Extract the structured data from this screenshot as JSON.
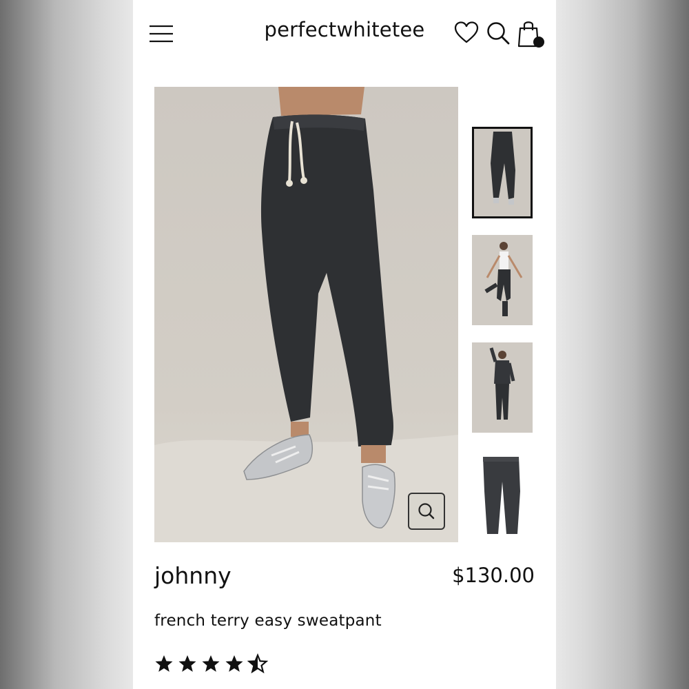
{
  "header": {
    "logo_text": "perfectwhitetee",
    "icons": [
      "menu-icon",
      "heart-icon",
      "search-icon",
      "shopping-bag-icon"
    ],
    "cart_dot_color": "#111111"
  },
  "gallery": {
    "main_image_alt": "black sweatpants with white drawstring and silver sneakers",
    "thumbnails": [
      "front view",
      "full body pose with white tank",
      "full body with long sleeve top",
      "flat lay"
    ],
    "active_thumbnail": 1,
    "zoom_icon": "search-icon"
  },
  "product": {
    "name": "johnny",
    "price": "$130.00",
    "description": "french terry easy sweatpant",
    "rating": 4.5,
    "rating_max": 5
  }
}
